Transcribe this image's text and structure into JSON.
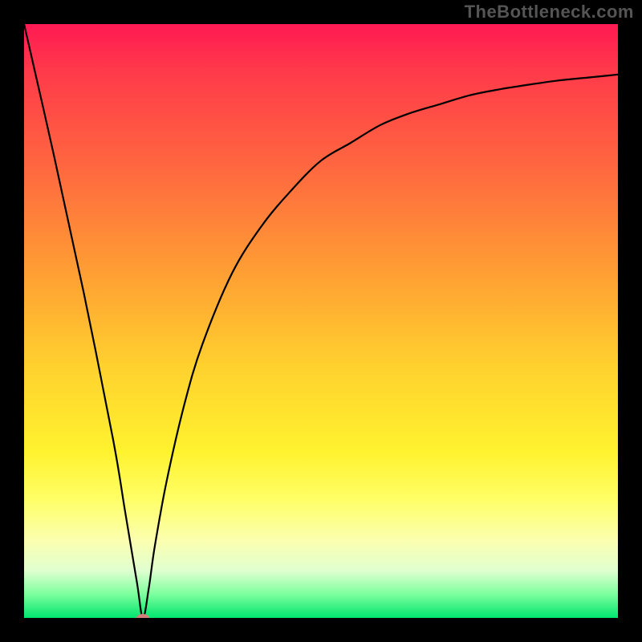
{
  "watermark": "TheBottleneck.com",
  "chart_data": {
    "type": "line",
    "title": "",
    "xlabel": "",
    "ylabel": "",
    "xlim": [
      0,
      100
    ],
    "ylim": [
      0,
      100
    ],
    "grid": false,
    "legend": false,
    "x": [
      0,
      5,
      10,
      15,
      17,
      19,
      20,
      21,
      22,
      24,
      27,
      30,
      35,
      40,
      45,
      50,
      55,
      60,
      65,
      70,
      75,
      80,
      85,
      90,
      95,
      100
    ],
    "values": [
      100,
      78,
      55,
      30,
      18,
      6,
      0,
      5,
      12,
      23,
      36,
      46,
      58,
      66,
      72,
      77,
      80,
      83,
      85,
      86.5,
      88,
      89,
      89.8,
      90.5,
      91,
      91.5
    ],
    "marker": {
      "x": 20,
      "y": 0
    }
  },
  "colors": {
    "curve": "#000000",
    "marker": "#d48079",
    "frame": "#000000"
  }
}
